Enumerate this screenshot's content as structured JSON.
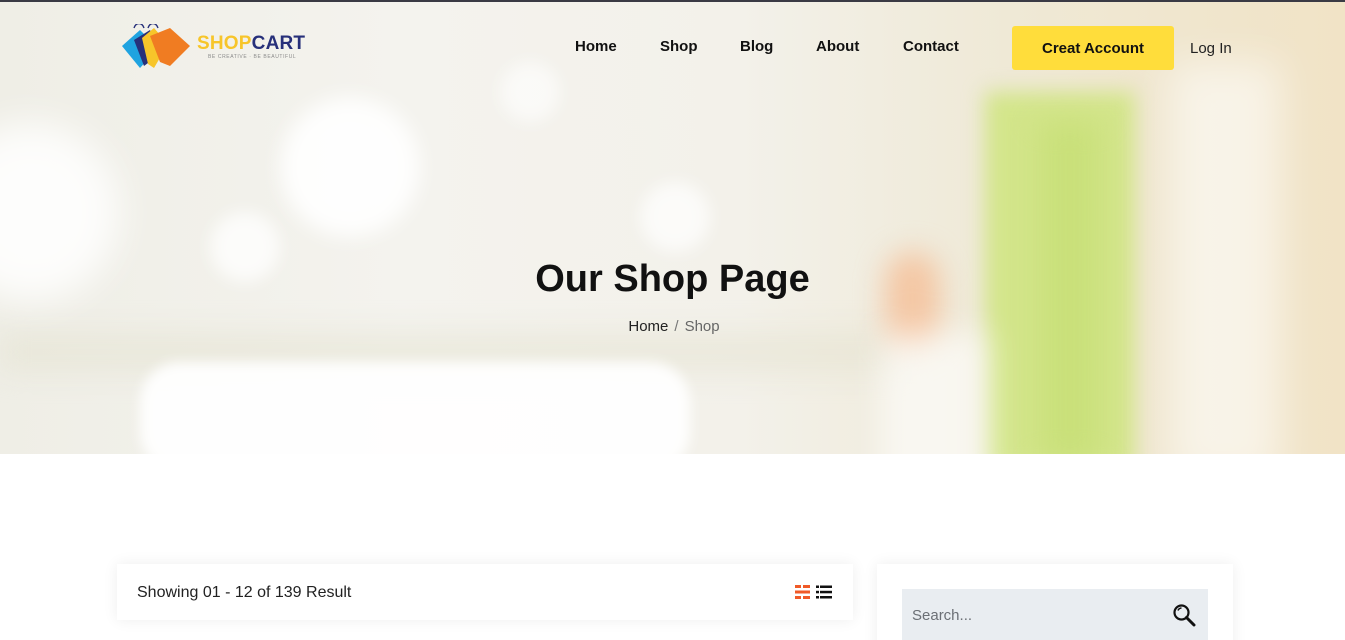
{
  "brand": {
    "name_part1": "SHOP",
    "name_part2": "CART",
    "tagline": "BE CREATIVE · BE BEAUTIFUL",
    "colors": {
      "yellow": "#f7c52a",
      "navy": "#27307a",
      "orange": "#f07c22",
      "blue": "#1fa3e0"
    }
  },
  "nav": {
    "items": [
      {
        "label": "Home"
      },
      {
        "label": "Shop"
      },
      {
        "label": "Blog"
      },
      {
        "label": "About"
      },
      {
        "label": "Contact"
      }
    ],
    "create_account_label": "Creat Account",
    "login_label": "Log In"
  },
  "hero": {
    "title": "Our Shop Page",
    "breadcrumb": {
      "home": "Home",
      "separator": "/",
      "current": "Shop"
    }
  },
  "results": {
    "text": "Showing 01 - 12 of 139 Result",
    "views": {
      "grid_icon": "grid-view-icon",
      "list_icon": "list-view-icon",
      "active_color": "#f05a28"
    }
  },
  "sidebar": {
    "search": {
      "placeholder": "Search...",
      "icon": "search-icon"
    }
  },
  "colors": {
    "button_yellow": "#ffdd3b",
    "search_bg": "#e9edf1"
  }
}
